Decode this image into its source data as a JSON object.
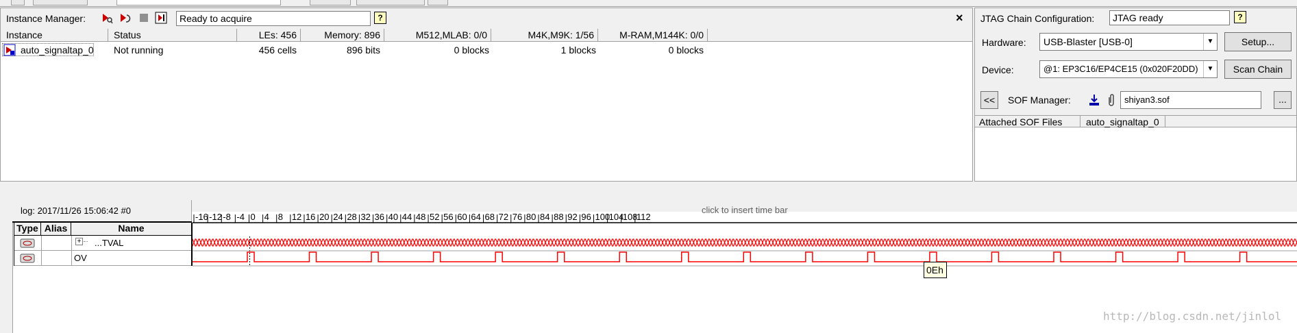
{
  "instance_manager": {
    "title": "Instance Manager:",
    "status_text": "Ready to acquire",
    "help": "?",
    "close": "×",
    "columns": [
      "Instance",
      "Status",
      "LEs: 456",
      "Memory: 896",
      "M512,MLAB: 0/0",
      "M4K,M9K: 1/56",
      "M-RAM,M144K: 0/0"
    ],
    "row": {
      "instance": "auto_signaltap_0",
      "status": "Not running",
      "les": "456 cells",
      "memory": "896 bits",
      "m512": "0 blocks",
      "m4k": "1 blocks",
      "mram": "0 blocks"
    }
  },
  "jtag": {
    "title": "JTAG Chain Configuration:",
    "status": "JTAG ready",
    "help": "?",
    "hardware_label": "Hardware:",
    "hardware_value": "USB-Blaster [USB-0]",
    "setup_button": "Setup...",
    "device_label": "Device:",
    "device_value": "@1: EP3C16/EP4CE15 (0x020F20DD)",
    "scan_button": "Scan Chain",
    "collapse_button": "<<",
    "sof_label": "SOF Manager:",
    "sof_file": "shiyan3.sof",
    "browse_button": "...",
    "columns": [
      "Attached SOF Files",
      "auto_signaltap_0"
    ]
  },
  "waveform": {
    "log": "log: 2017/11/26 15:06:42  #0",
    "insert_hint": "click to insert time bar",
    "columns": [
      "Type",
      "Alias",
      "Name"
    ],
    "signals": [
      {
        "expand": "+",
        "name": "...TVAL"
      },
      {
        "expand": "",
        "name": "OV"
      }
    ],
    "ruler_ticks": [
      "-16",
      "-12",
      "-8",
      "-4",
      "0",
      "4",
      "8",
      "12",
      "16",
      "20",
      "24",
      "28",
      "32",
      "36",
      "40",
      "44",
      "48",
      "52",
      "56",
      "60",
      "64",
      "68",
      "72",
      "76",
      "80",
      "84",
      "88",
      "92",
      "96",
      "100",
      "104",
      "108",
      "112"
    ],
    "tooltip": "0Eh",
    "colors": {
      "signal": "#ff0000",
      "grid": "#000000"
    }
  },
  "watermark": "http://blog.csdn.net/jinlol"
}
